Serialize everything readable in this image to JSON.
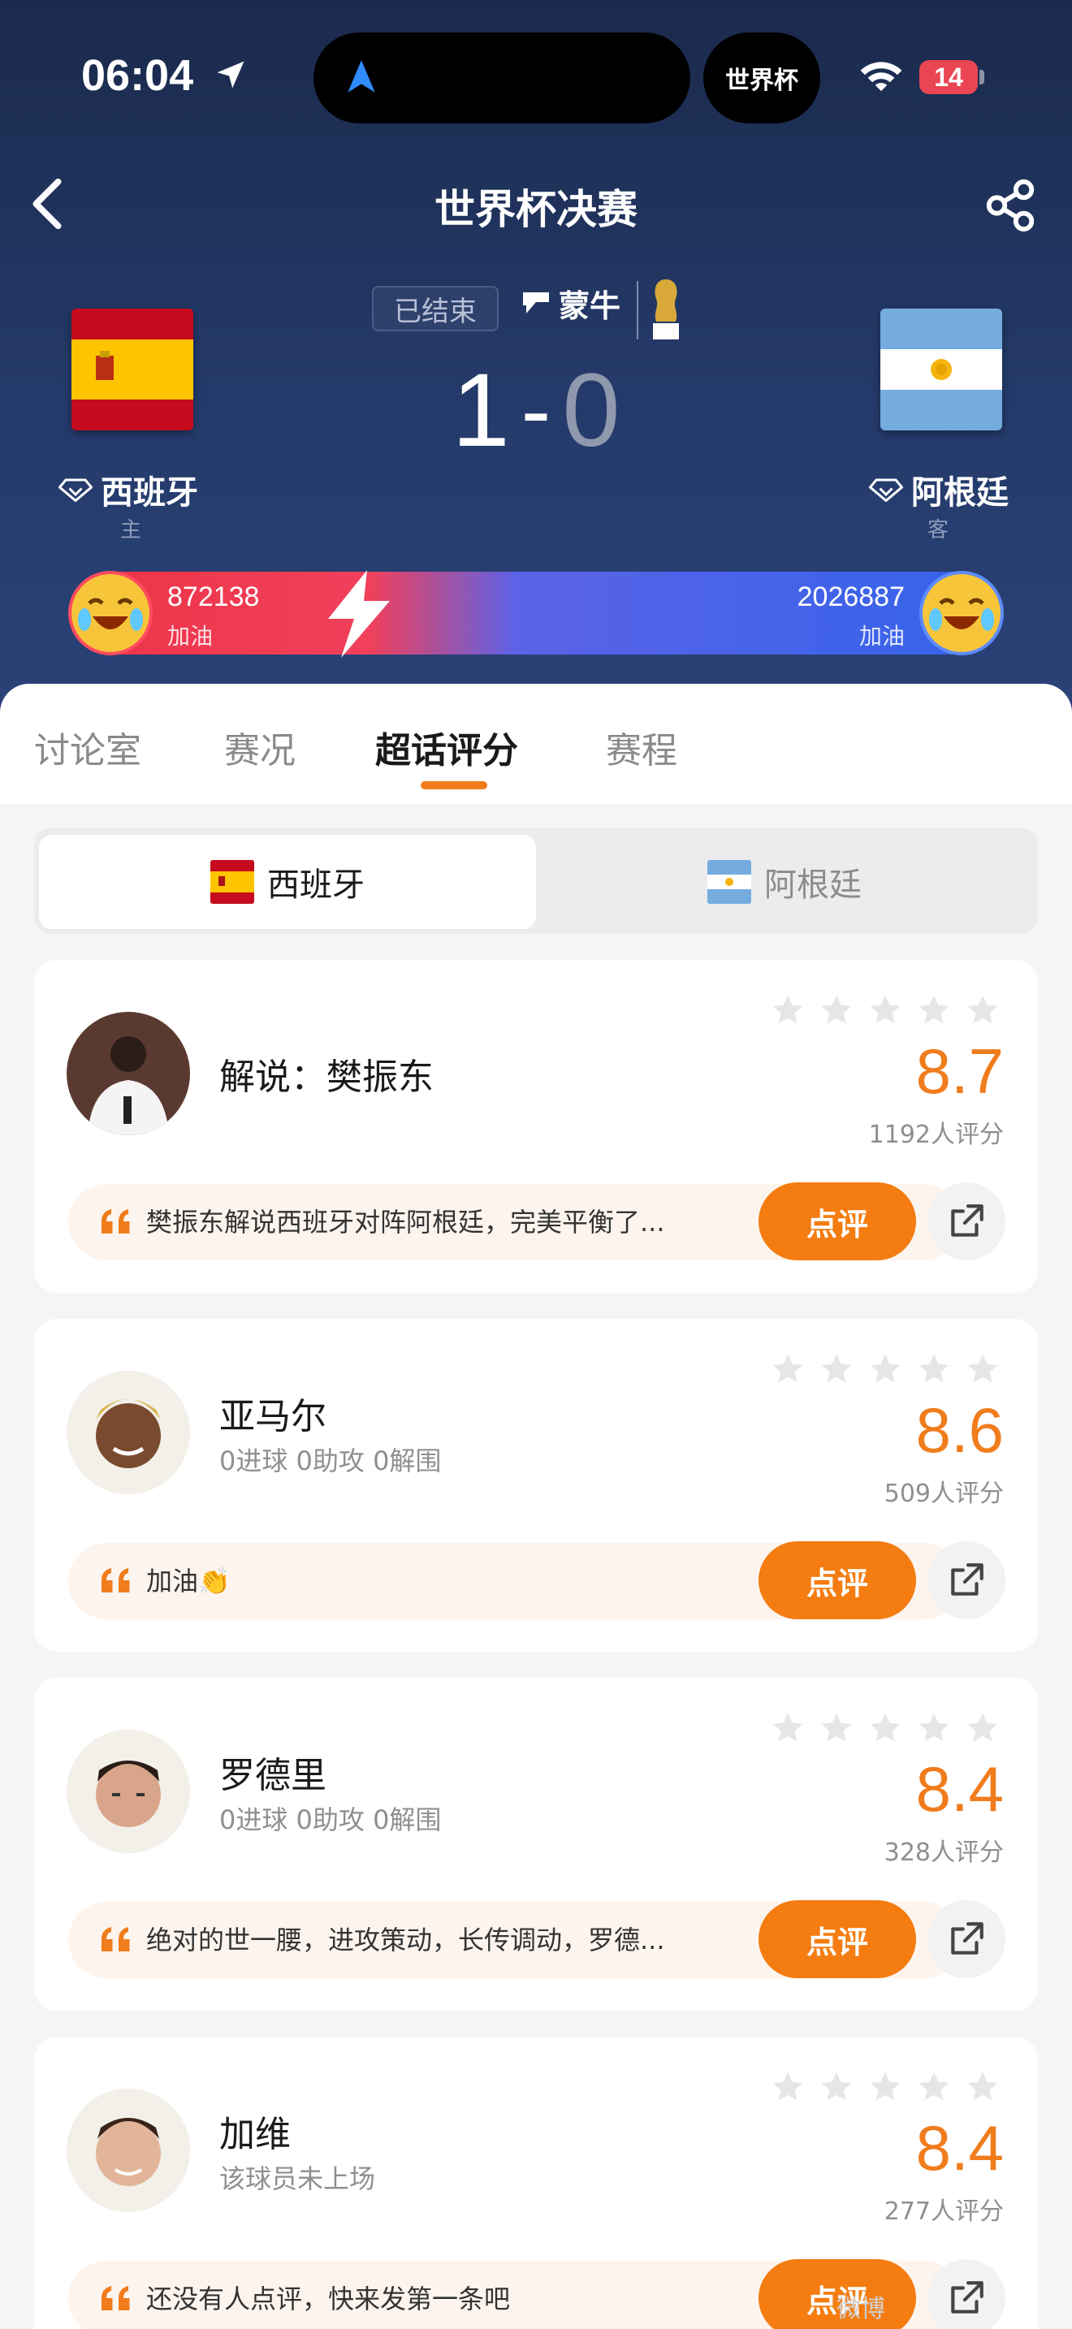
{
  "status_bar": {
    "time": "06:04",
    "island_label": "世界杯",
    "battery": "14"
  },
  "header": {
    "title": "世界杯决赛",
    "match_status": "已结束",
    "sponsor": "蒙牛",
    "score_home": "1",
    "score_separator": "-",
    "score_away": "0",
    "home_team": {
      "name": "西班牙",
      "role": "主"
    },
    "away_team": {
      "name": "阿根廷",
      "role": "客"
    }
  },
  "cheer": {
    "home_count": "872138",
    "home_label": "加油",
    "away_count": "2026887",
    "away_label": "加油"
  },
  "tabs": [
    {
      "label": "讨论室"
    },
    {
      "label": "赛况"
    },
    {
      "label": "超话评分"
    },
    {
      "label": "赛程"
    }
  ],
  "active_tab": "超话评分",
  "team_switch": {
    "home": "西班牙",
    "away": "阿根廷",
    "selected": "西班牙"
  },
  "players": [
    {
      "name": "解说：樊振东",
      "stats": "",
      "rating": "8.7",
      "raters": "1192人评分",
      "comment": "樊振东解说西班牙对阵阿根廷，完美平衡了...",
      "button": "点评"
    },
    {
      "name": "亚马尔",
      "stats": "0进球 0助攻 0解围",
      "rating": "8.6",
      "raters": "509人评分",
      "comment": "加油👏",
      "button": "点评"
    },
    {
      "name": "罗德里",
      "stats": "0进球 0助攻 0解围",
      "rating": "8.4",
      "raters": "328人评分",
      "comment": "绝对的世一腰，进攻策动，长传调动，罗德...",
      "button": "点评"
    },
    {
      "name": "加维",
      "stats": "该球员未上场",
      "rating": "8.4",
      "raters": "277人评分",
      "comment": "还没有人点评，快来发第一条吧",
      "button": "点评"
    }
  ],
  "watermark": "微博",
  "colors": {
    "accent": "#f47c10",
    "header_bg": "#1b2a4c",
    "cheer_home": "#ee3347",
    "cheer_away": "#3363ea"
  },
  "icons": [
    "location-arrow-icon",
    "wifi-icon",
    "back-icon",
    "share-icon",
    "quote-icon",
    "external-link-icon",
    "star-icon",
    "lightning-icon",
    "cheer-emoji-icon"
  ]
}
